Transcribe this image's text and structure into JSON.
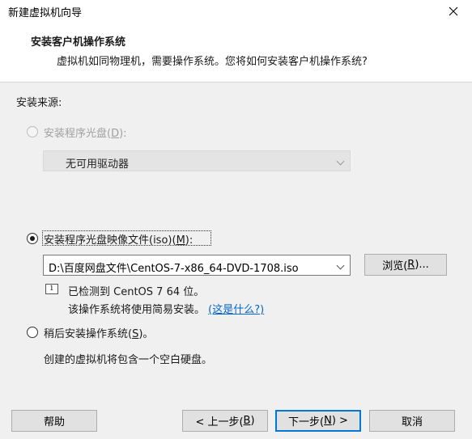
{
  "window": {
    "title": "新建虚拟机向导"
  },
  "header": {
    "title": "安装客户机操作系统",
    "subtitle": "虚拟机如同物理机，需要操作系统。您将如何安装客户机操作系统?"
  },
  "install_source": {
    "label": "安装来源:",
    "option_disc": {
      "label_main": "安装程序光盘(",
      "mnemonic": "D",
      "label_end": "):",
      "selected": false,
      "enabled": false
    },
    "disc_drive": {
      "value": "无可用驱动器"
    },
    "option_iso": {
      "label_main": "安装程序光盘映像文件(iso)(",
      "mnemonic": "M",
      "label_end": "):",
      "selected": true
    },
    "iso_path": {
      "value": "D:\\百度网盘文件\\CentOS-7-x86_64-DVD-1708.iso"
    },
    "browse_button": {
      "label_main": "浏览(",
      "mnemonic": "R",
      "label_end": ")..."
    },
    "detection": {
      "line1": "已检测到 CentOS 7 64 位。",
      "line2": "该操作系统将使用简易安装。",
      "link": "(这是什么?)"
    },
    "option_later": {
      "label_main": "稍后安装操作系统(",
      "mnemonic": "S",
      "label_end": ")。",
      "selected": false
    },
    "later_desc": "创建的虚拟机将包含一个空白硬盘。"
  },
  "footer": {
    "help": "帮助",
    "back": {
      "label_main": "< 上一步(",
      "mnemonic": "B",
      "label_end": ")"
    },
    "next": {
      "label_main": "下一步(",
      "mnemonic": "N",
      "label_end": ") >"
    },
    "cancel": "取消"
  },
  "colors": {
    "accent": "#0078d7",
    "link": "#0066cc",
    "disabled_text": "#a0a0a0"
  }
}
